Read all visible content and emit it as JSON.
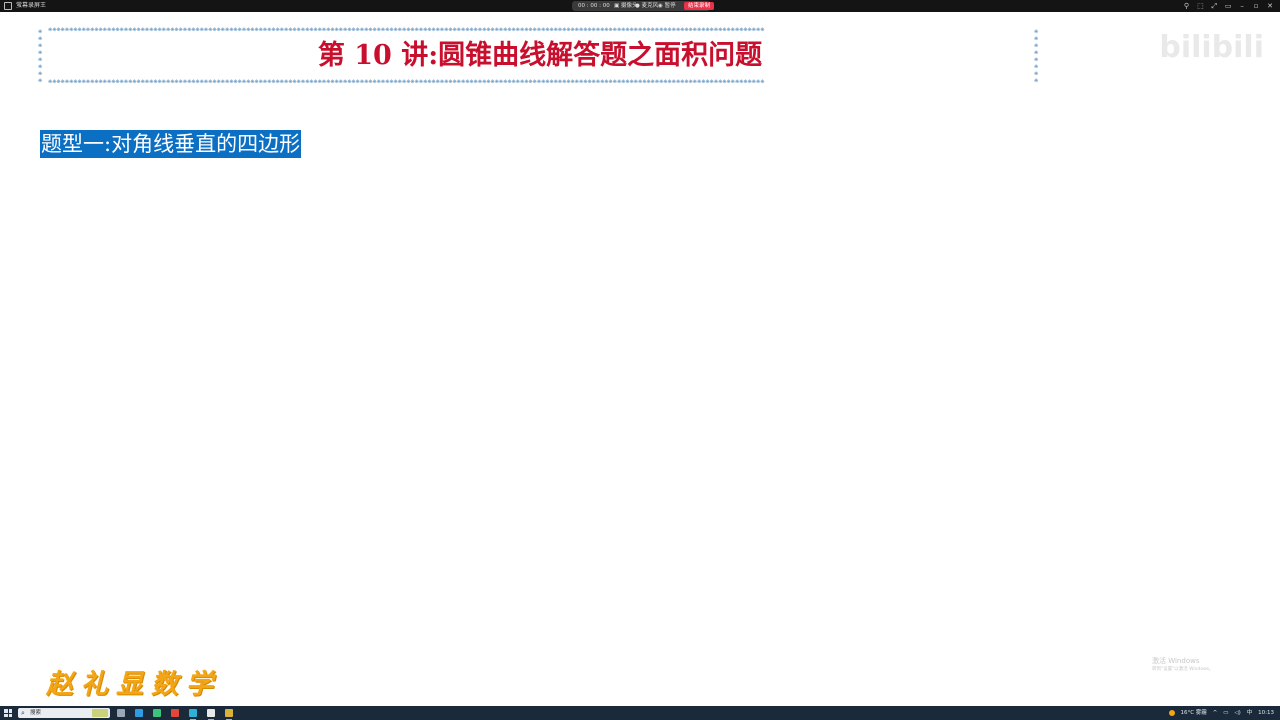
{
  "window": {
    "app_title": "萤幕录屏王",
    "recording": {
      "timer": "00 : 00 : 00",
      "camera_label": "摄像头",
      "mic_label": "麦克风",
      "pause_label": "暂停",
      "end_label": "结束录制"
    },
    "controls": [
      "⚲",
      "⬚",
      "⤢",
      "▭",
      "–",
      "▫",
      "✕"
    ]
  },
  "slide": {
    "lecture_title": "第 10 讲:圆锥曲线解答题之面积问题",
    "star_border_color": "#5a8fbf",
    "title_color": "#c8102e",
    "section_title": "题型一:对角线垂直的四边形",
    "section_highlight_color": "#0b6fc4",
    "brand": "赵礼显数学",
    "watermark": "bilibili"
  },
  "activation": {
    "line1": "激活 Windows",
    "line2": "转到\"设置\"以激活 Windows。"
  },
  "taskbar": {
    "search_placeholder": "搜索",
    "apps": [
      {
        "name": "task-view",
        "color": "#9aa7b4"
      },
      {
        "name": "edge",
        "color": "#2f9be0"
      },
      {
        "name": "explorer",
        "color": "#3cc27a"
      },
      {
        "name": "wps",
        "color": "#e0483a"
      },
      {
        "name": "store",
        "color": "#2fb0d8"
      },
      {
        "name": "office",
        "color": "#e8e8e8"
      },
      {
        "name": "recorder",
        "color": "#d8b23a"
      }
    ],
    "weather": "16°C 雾霾",
    "input_method": "中",
    "time": "10:13"
  }
}
